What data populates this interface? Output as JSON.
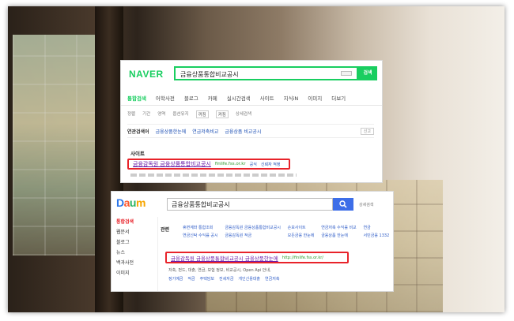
{
  "naver": {
    "logo": "NAVER",
    "search_value": "금융상품통합비교공시",
    "search_button": "검색",
    "tabs": [
      {
        "label": "통합검색",
        "active": true
      },
      {
        "label": "어학사전"
      },
      {
        "label": "블로그"
      },
      {
        "label": "카페"
      },
      {
        "label": "실시간검색"
      },
      {
        "label": "사이트"
      },
      {
        "label": "지식iN"
      },
      {
        "label": "이미지"
      },
      {
        "label": "더보기"
      }
    ],
    "filters": {
      "sort": "정렬",
      "period": "기간",
      "area": "영역",
      "option": "옵션유지",
      "option_state": "꺼짐",
      "option_state2": "켜짐",
      "detail": "상세검색"
    },
    "related": {
      "heading": "연관검색어",
      "links": [
        "금융상품한눈에",
        "연금저축비교",
        "금융상품 비교공시"
      ],
      "close": "신고"
    },
    "site_heading": "사이트",
    "site_result": {
      "title": "금융감독원 금융상품통합비교공시",
      "url": "finlife.fss.or.kr",
      "meta1": "공식",
      "meta2": "신뢰자 적정"
    }
  },
  "daum": {
    "logo_letters": [
      "D",
      "a",
      "u",
      "m"
    ],
    "search_value": "금융상품통합비교공시",
    "detail_link": "상세검색",
    "sidebar": [
      {
        "label": "통합검색",
        "active": true
      },
      {
        "label": "웹문서"
      },
      {
        "label": "블로그"
      },
      {
        "label": "뉴스"
      },
      {
        "label": "백과사전"
      },
      {
        "label": "이미지"
      }
    ],
    "related_heading": "관련",
    "related_links": [
      "휴면계좌 통합조회",
      "금융감독원 금융상품통합비교공시",
      "손보사이트",
      "연금저축 수익률 비교",
      "연금",
      "연금신탁 수익률 공시",
      "금융감독원 적금",
      "모든금융 한눈에",
      "금융상품 한눈에",
      "서민금융 1332"
    ],
    "result": {
      "title": "금융감독원 금융상품통합비교공시 금융상품한눈에",
      "url": "http://finlife.fss.or.kr/"
    },
    "desc": "저축, 펀드, 대출, 연금, 보험 정보, 비교공시, Open Api 안내,",
    "sublinks": [
      "정기예금",
      "적금",
      "주택담보",
      "전세자금",
      "개인신용대출",
      "연금저축"
    ]
  }
}
